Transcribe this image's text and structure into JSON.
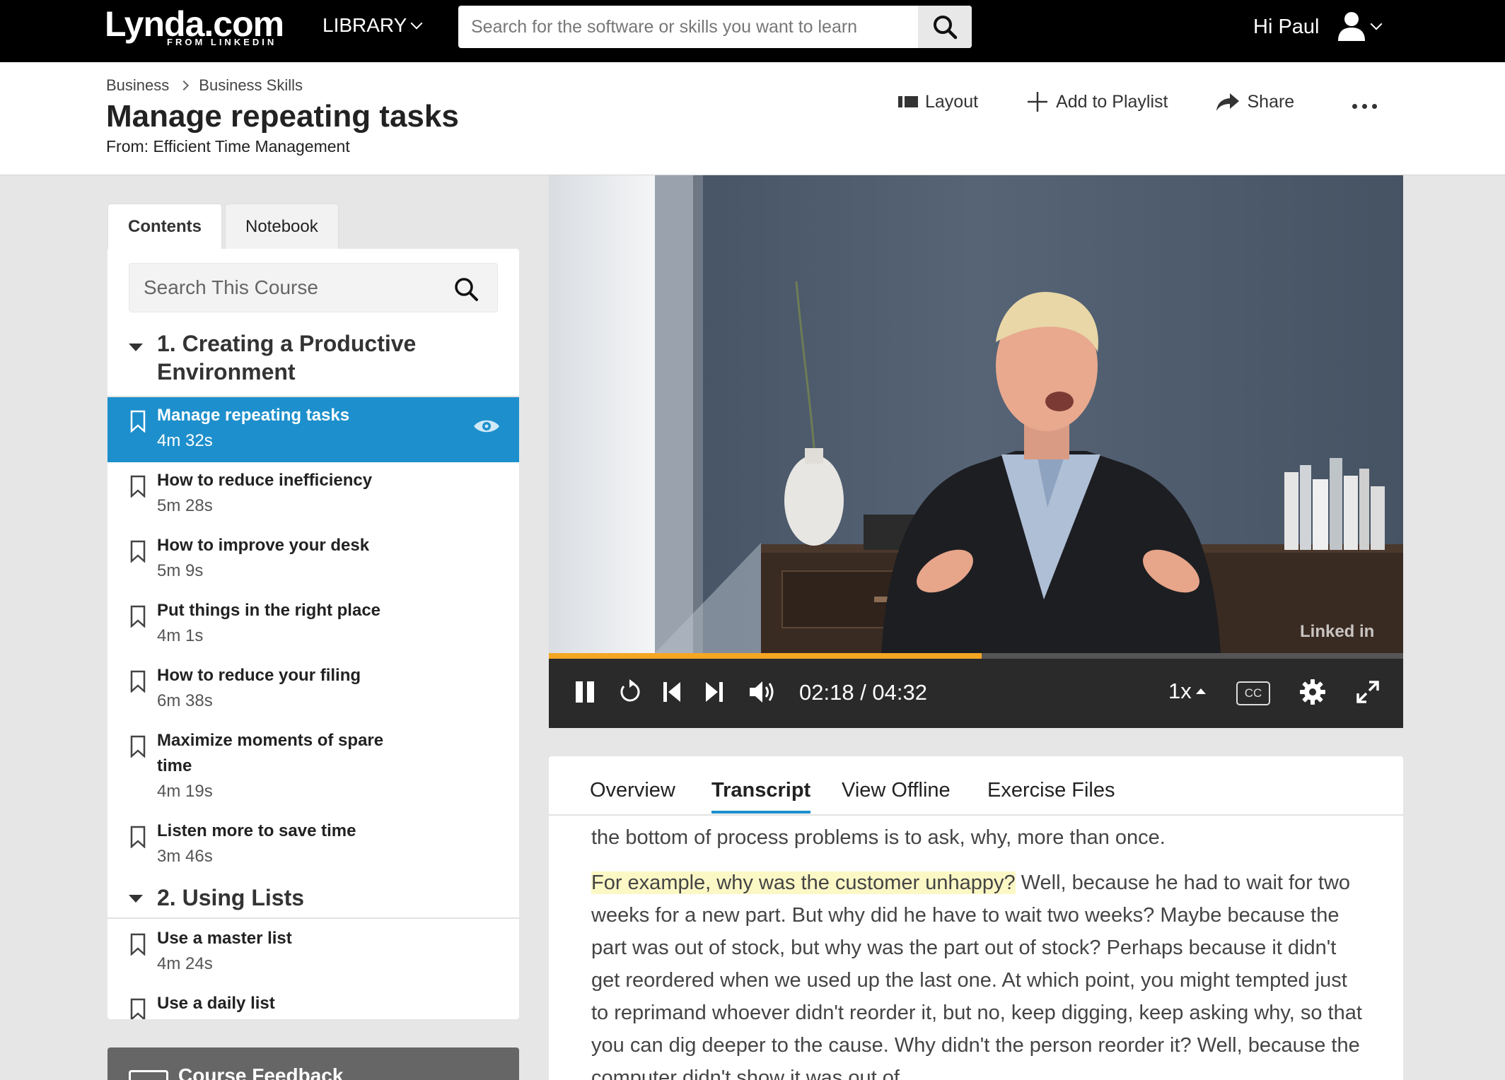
{
  "nav": {
    "logo": "Lynda.com",
    "logo_sub": "FROM LINKEDIN",
    "library": "LIBRARY",
    "search_placeholder": "Search for the software or skills you want to learn",
    "greeting": "Hi Paul"
  },
  "header": {
    "breadcrumbs": [
      "Business",
      "Business Skills"
    ],
    "title": "Manage repeating tasks",
    "from": "From: Efficient Time Management",
    "actions": {
      "layout": "Layout",
      "playlist": "Add to Playlist",
      "share": "Share"
    }
  },
  "sidebar": {
    "tabs": [
      "Contents",
      "Notebook"
    ],
    "search_placeholder": "Search This Course",
    "chapter1": "1. Creating a Productive Environment",
    "chapter2": "2. Using Lists",
    "lessons": [
      {
        "title": "Manage repeating tasks",
        "duration": "4m 32s"
      },
      {
        "title": "How to reduce inefficiency",
        "duration": "5m 28s"
      },
      {
        "title": "How to improve your desk",
        "duration": "5m 9s"
      },
      {
        "title": "Put things in the right place",
        "duration": "4m 1s"
      },
      {
        "title": "How to reduce your filing",
        "duration": "6m 38s"
      },
      {
        "title": "Maximize moments of spare time",
        "duration": "4m 19s"
      },
      {
        "title": "Listen more to save time",
        "duration": "3m 46s"
      },
      {
        "title": "Use a master list",
        "duration": "4m 24s"
      },
      {
        "title": "Use a daily list",
        "duration": ""
      }
    ],
    "feedback": "Course Feedback"
  },
  "player": {
    "time": "02:18 / 04:32",
    "progress": 0.507,
    "speed": "1x",
    "cc": "CC",
    "watermark": "Linked in",
    "accent": "#f5a623"
  },
  "panel": {
    "tabs": [
      "Overview",
      "Transcript",
      "View Offline",
      "Exercise Files"
    ],
    "transcript_p1": "the bottom of process problems is to ask, why, more than once.",
    "transcript_hl": "For example, why was the customer unhappy?",
    "transcript_p2": " Well, because he had to wait for two weeks for a new part. But why did he have to wait two weeks? Maybe because the part was out of stock, but why was the part out of stock? Perhaps because it didn't get reordered when we used up the last one. At which point, you might tempted just to reprimand whoever didn't reorder it, but no, keep digging, keep asking why, so that you can dig deeper to the cause. Why didn't the person reorder it? Well, because the computer didn't show it was out of"
  },
  "colors": {
    "brand_blue": "#1d8fcc",
    "nav_bg": "#000000"
  }
}
